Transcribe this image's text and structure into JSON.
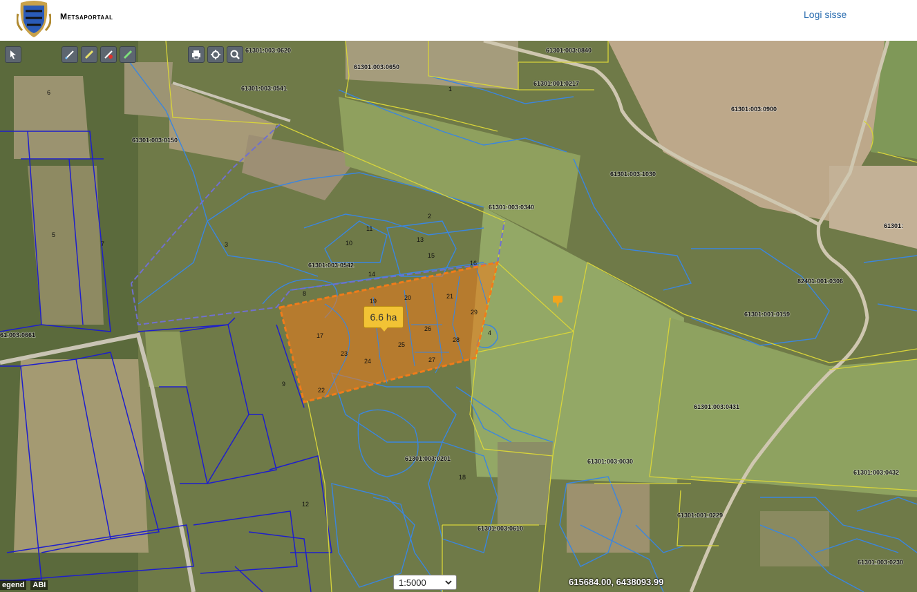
{
  "header": {
    "brand": "Metsaportaal",
    "login": "Logi sisse"
  },
  "toolbar": {
    "left_tools": [
      "select-tool",
      "draw-line-tool",
      "draw-polygon-tool",
      "remove-drawing-tool",
      "measure-tool"
    ],
    "right_tools": [
      "print-tool",
      "locate-tool",
      "zoom-tool"
    ]
  },
  "map": {
    "area_measurement": "6.6 ha",
    "parcel_labels": [
      "61301:003:0620",
      "61301:003:0650",
      "61301:003:0840",
      "61301:001:0217",
      "61301:003:0541",
      "61301:003:0900",
      "61301:003:0150",
      "61301:003:1030",
      "61301:003:0340",
      "61301:003:0542",
      "82401:001:0306",
      "61301:001:0159",
      "61:003:0661",
      "61301:003:0431",
      "61301:003:0201",
      "61301:003:0030",
      "61301:003:0432",
      "61301:001:0229",
      "61301:003:0610",
      "61301:003:0230",
      "61301:"
    ],
    "stand_numbers": [
      "17",
      "23",
      "24",
      "25",
      "26",
      "27",
      "28",
      "29",
      "19",
      "20",
      "21",
      "22",
      "13",
      "14",
      "15",
      "16",
      "5",
      "6",
      "8",
      "9",
      "10",
      "11",
      "12",
      "18",
      "2",
      "3",
      "4",
      "7",
      "1"
    ]
  },
  "footer": {
    "legend": "egend",
    "abi": "ABI",
    "scale": "1:5000",
    "coordinates": "615684.00, 6438093.99"
  },
  "colors": {
    "cadastre": "#d8d43a",
    "stand_blue": "#2f6fcf",
    "forest_blue": "#1e1ecc",
    "selection": "#f07c1a",
    "tooltip": "#f2c335"
  }
}
